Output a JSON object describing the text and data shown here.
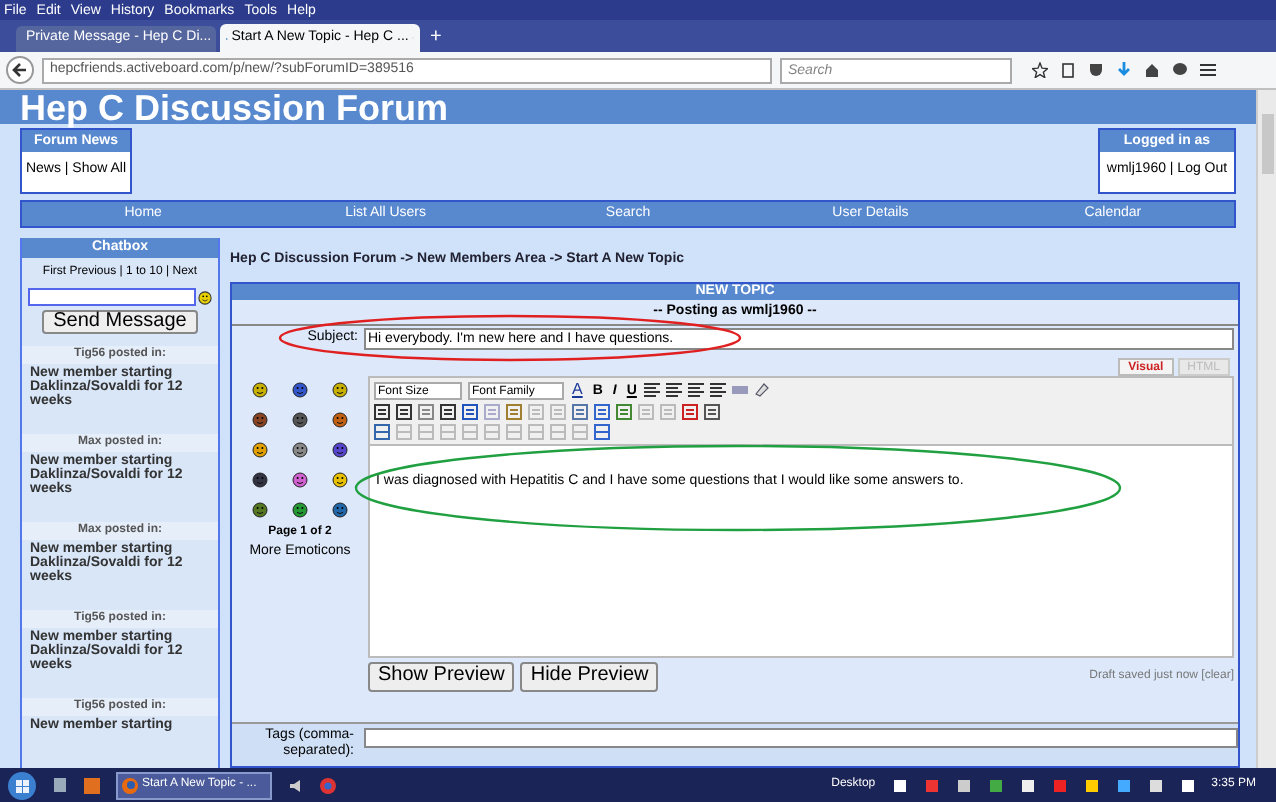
{
  "browser": {
    "menu": [
      "File",
      "Edit",
      "View",
      "History",
      "Bookmarks",
      "Tools",
      "Help"
    ],
    "tabs": [
      {
        "title": "Private Message - Hep C Di...",
        "selected": false
      },
      {
        "title": "Start A New Topic - Hep C ...",
        "selected": true
      }
    ],
    "new_tab": "+",
    "url": "hepcfriends.activeboard.com/p/new/?subForumID=389516",
    "search": {
      "placeholder": "Search"
    }
  },
  "forum": {
    "title": "Hep C Discussion Forum",
    "news_box": {
      "heading": "Forum News",
      "links": "News | Show All"
    },
    "login_box": {
      "heading": "Logged in as",
      "links": "wmlj1960 | Log Out"
    },
    "nav": [
      "Home",
      "List All Users",
      "Search",
      "User Details",
      "Calendar"
    ]
  },
  "chatbox": {
    "heading": "Chatbox",
    "pager": "First Previous | 1 to 10 | Next",
    "send": "Send Message",
    "posts": [
      {
        "author": "Tig56 posted in:",
        "title": "New member starting Daklinza/Sovaldi for 12 weeks"
      },
      {
        "author": "Max posted in:",
        "title": "New member starting Daklinza/Sovaldi for 12 weeks"
      },
      {
        "author": "Max posted in:",
        "title": "New member starting Daklinza/Sovaldi for 12 weeks"
      },
      {
        "author": "Tig56 posted in:",
        "title": "New member starting Daklinza/Sovaldi for 12 weeks"
      },
      {
        "author": "Tig56 posted in:",
        "title": "New member starting"
      }
    ]
  },
  "breadcrumb": "Hep C Discussion Forum -> New Members Area -> Start A New Topic",
  "form": {
    "heading": "NEW TOPIC",
    "posting_as": "-- Posting as wmlj1960 --",
    "subject_label": "Subject:",
    "subject": "Hi everybody. I'm new here and I have questions.",
    "editor_tabs": [
      {
        "label": "Visual",
        "selected": true
      },
      {
        "label": "HTML",
        "selected": false
      }
    ],
    "font_size": "Font Size",
    "font_family": "Font Family",
    "format_buttons": [
      "A",
      "B",
      "I",
      "U"
    ],
    "body": "I was diagnosed with Hepatitis C and I have some questions that I would like some answers to.",
    "emoticons_page": "Page 1 of 2",
    "more_emoticons": "More Emoticons",
    "buttons": [
      "Show Preview",
      "Hide Preview"
    ],
    "draft_status": "Draft saved just now [clear]",
    "tags_label": "Tags (comma-separated):"
  },
  "annotations": [
    {
      "kind": "ellipse",
      "color": "#e02020"
    },
    {
      "kind": "ellipse",
      "color": "#20a040"
    }
  ],
  "taskbar": {
    "active_task": "Start A New Topic - ...",
    "desktop": "Desktop",
    "time": "3:35 PM"
  }
}
